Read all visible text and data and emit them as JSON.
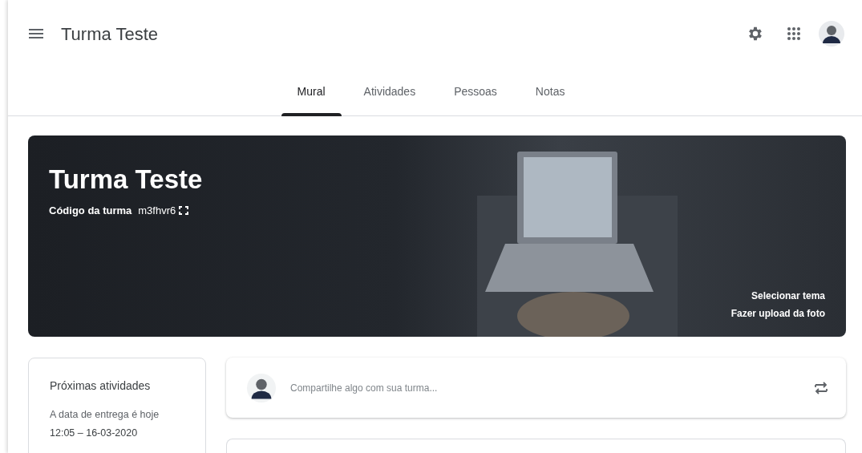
{
  "app_bar": {
    "title": "Turma Teste"
  },
  "tabs": [
    {
      "label": "Mural",
      "selected": true
    },
    {
      "label": "Atividades",
      "selected": false
    },
    {
      "label": "Pessoas",
      "selected": false
    },
    {
      "label": "Notas",
      "selected": false
    }
  ],
  "banner": {
    "title": "Turma Teste",
    "code_label": "Código da turma",
    "code": "m3fhvr6",
    "links": [
      "Selecionar tema",
      "Fazer upload da foto"
    ]
  },
  "upcoming": {
    "title": "Próximas atividades",
    "items": [
      {
        "text": "A data de entrega é hoje",
        "time": "12:05 – 16-03-2020"
      }
    ]
  },
  "share": {
    "placeholder": "Compartilhe algo com sua turma..."
  }
}
